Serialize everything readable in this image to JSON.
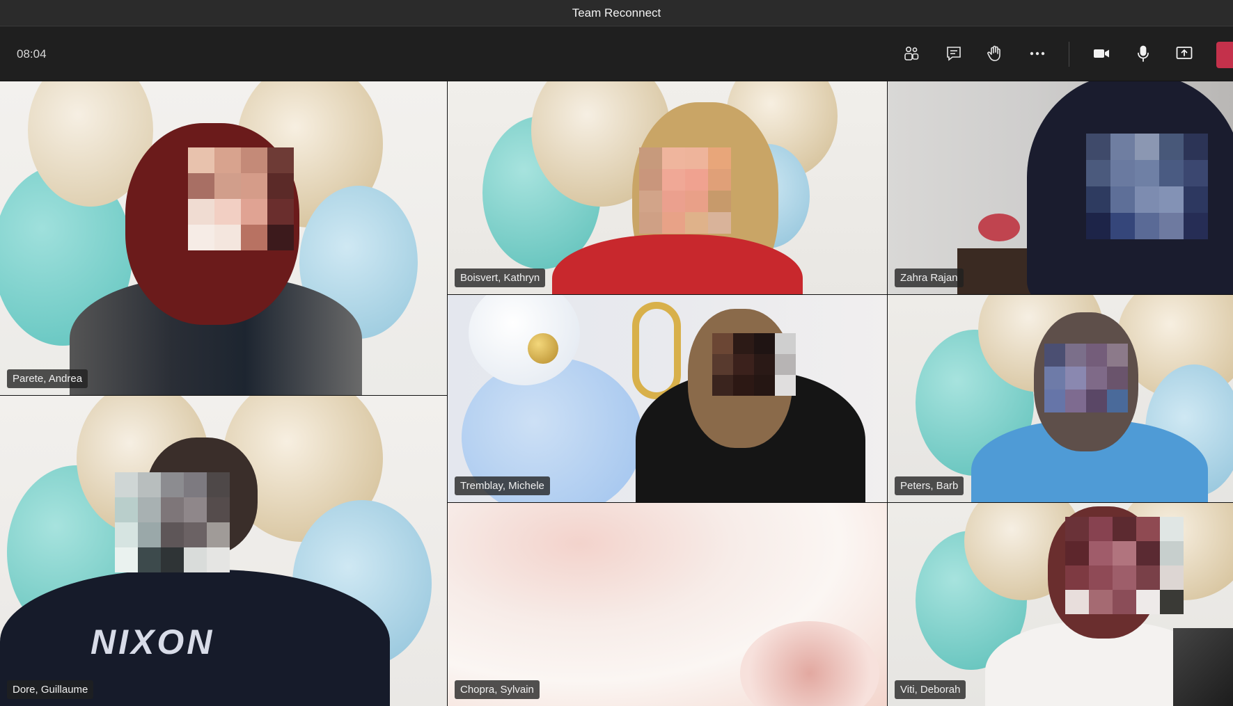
{
  "window": {
    "title": "Team Reconnect"
  },
  "toolbar": {
    "timer": "08:04",
    "buttons": [
      {
        "name": "participants-icon"
      },
      {
        "name": "chat-icon"
      },
      {
        "name": "raise-hand-icon"
      },
      {
        "name": "more-options-icon"
      },
      {
        "name": "camera-icon"
      },
      {
        "name": "microphone-icon"
      },
      {
        "name": "share-screen-icon"
      }
    ]
  },
  "participants": [
    {
      "name": "Parete, Andrea"
    },
    {
      "name": "Boisvert, Kathryn"
    },
    {
      "name": "Zahra Rajan"
    },
    {
      "name": "Tremblay, Michele"
    },
    {
      "name": "Peters, Barb"
    },
    {
      "name": "Dore, Guillaume"
    },
    {
      "name": "Chopra, Sylvain"
    },
    {
      "name": "Viti, Deborah"
    }
  ],
  "colors": {
    "leave_button": "#c4314b",
    "titlebar": "#2b2b2b",
    "toolbar": "#1f1f1f"
  },
  "shirt_text": "NIXON"
}
